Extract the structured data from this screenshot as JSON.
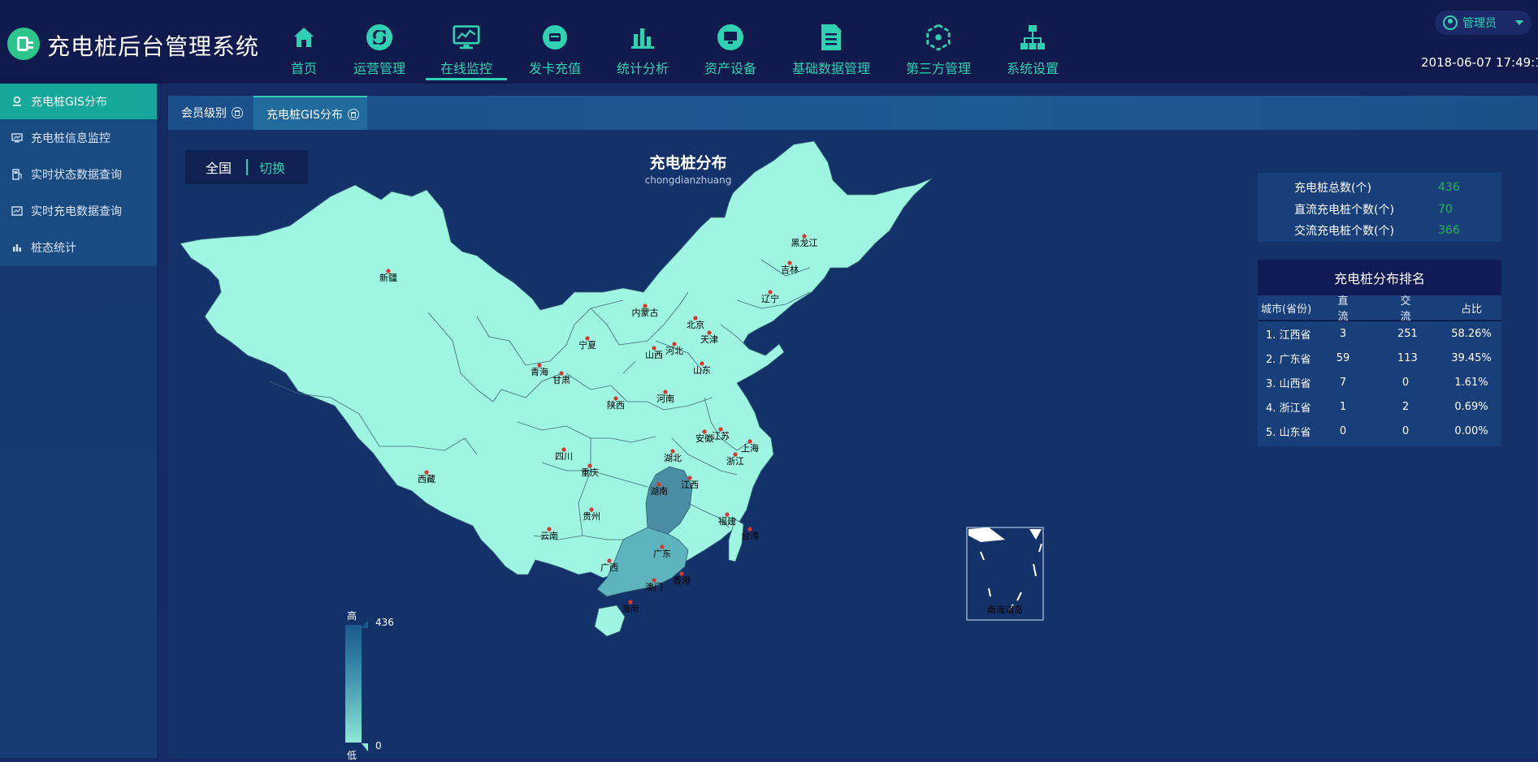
{
  "app": {
    "title": "充电桩后台管理系统",
    "accent": "#2fd1b2",
    "header_bg": "#111a4c"
  },
  "nav": {
    "items": [
      {
        "label": "首页",
        "icon": "home-icon"
      },
      {
        "label": "运营管理",
        "icon": "recycle-icon"
      },
      {
        "label": "在线监控",
        "icon": "monitor-chart-icon",
        "active": true
      },
      {
        "label": "发卡充值",
        "icon": "card-icon"
      },
      {
        "label": "统计分析",
        "icon": "bar-chart-icon"
      },
      {
        "label": "资产设备",
        "icon": "screen-icon"
      },
      {
        "label": "基础数据管理",
        "icon": "document-icon"
      },
      {
        "label": "第三方管理",
        "icon": "hexagon-icon"
      },
      {
        "label": "系统设置",
        "icon": "sitemap-icon"
      }
    ]
  },
  "user": {
    "label": "管理员",
    "icon": "user-icon"
  },
  "datetime": "2018-06-07 17:49:10",
  "sidebar": {
    "items": [
      {
        "label": "充电桩GIS分布",
        "icon": "location-icon",
        "active": true
      },
      {
        "label": "充电桩信息监控",
        "icon": "monitor-icon"
      },
      {
        "label": "实时状态数据查询",
        "icon": "fuel-icon"
      },
      {
        "label": "实时充电数据查询",
        "icon": "chart-icon"
      },
      {
        "label": "桩态统计",
        "icon": "bar-icon"
      }
    ]
  },
  "tabs": [
    {
      "label": "会员级别",
      "active": false
    },
    {
      "label": "充电桩GIS分布",
      "active": true
    }
  ],
  "region": {
    "current": "全国",
    "switch_label": "切换"
  },
  "map": {
    "title": "充电桩分布",
    "subtitle": "chongdianzhuang",
    "legend": {
      "high_label": "高",
      "low_label": "低",
      "max": "436",
      "min": "0"
    },
    "base_color": "#9ef6e2",
    "highlight_color": "#4a8ea6",
    "mid_color": "#5eb4bd",
    "provinces": [
      {
        "name": "新疆"
      },
      {
        "name": "西藏"
      },
      {
        "name": "青海"
      },
      {
        "name": "甘肃"
      },
      {
        "name": "内蒙古"
      },
      {
        "name": "黑龙江"
      },
      {
        "name": "吉林"
      },
      {
        "name": "辽宁"
      },
      {
        "name": "北京"
      },
      {
        "name": "天津"
      },
      {
        "name": "河北"
      },
      {
        "name": "山西"
      },
      {
        "name": "宁夏"
      },
      {
        "name": "陕西"
      },
      {
        "name": "山东"
      },
      {
        "name": "河南"
      },
      {
        "name": "四川"
      },
      {
        "name": "重庆"
      },
      {
        "name": "湖北"
      },
      {
        "name": "安徽"
      },
      {
        "name": "江苏"
      },
      {
        "name": "上海"
      },
      {
        "name": "浙江"
      },
      {
        "name": "江西"
      },
      {
        "name": "湖南"
      },
      {
        "name": "贵州"
      },
      {
        "name": "云南"
      },
      {
        "name": "广西"
      },
      {
        "name": "广东"
      },
      {
        "name": "福建"
      },
      {
        "name": "台湾"
      },
      {
        "name": "香港"
      },
      {
        "name": "澳门"
      },
      {
        "name": "海南"
      }
    ],
    "inset_label": "南海诸岛"
  },
  "stats": [
    {
      "label": "充电桩总数(个)",
      "value": "436"
    },
    {
      "label": "直流充电桩个数(个)",
      "value": "70"
    },
    {
      "label": "交流充电桩个数(个)",
      "value": "366"
    }
  ],
  "ranking": {
    "title": "充电桩分布排名",
    "headers": [
      "城市(省份)",
      "直流",
      "交流",
      "占比"
    ],
    "rows": [
      [
        "1. 江西省",
        "3",
        "251",
        "58.26%"
      ],
      [
        "2. 广东省",
        "59",
        "113",
        "39.45%"
      ],
      [
        "3. 山西省",
        "7",
        "0",
        "1.61%"
      ],
      [
        "4. 浙江省",
        "1",
        "2",
        "0.69%"
      ],
      [
        "5. 山东省",
        "0",
        "0",
        "0.00%"
      ]
    ]
  }
}
